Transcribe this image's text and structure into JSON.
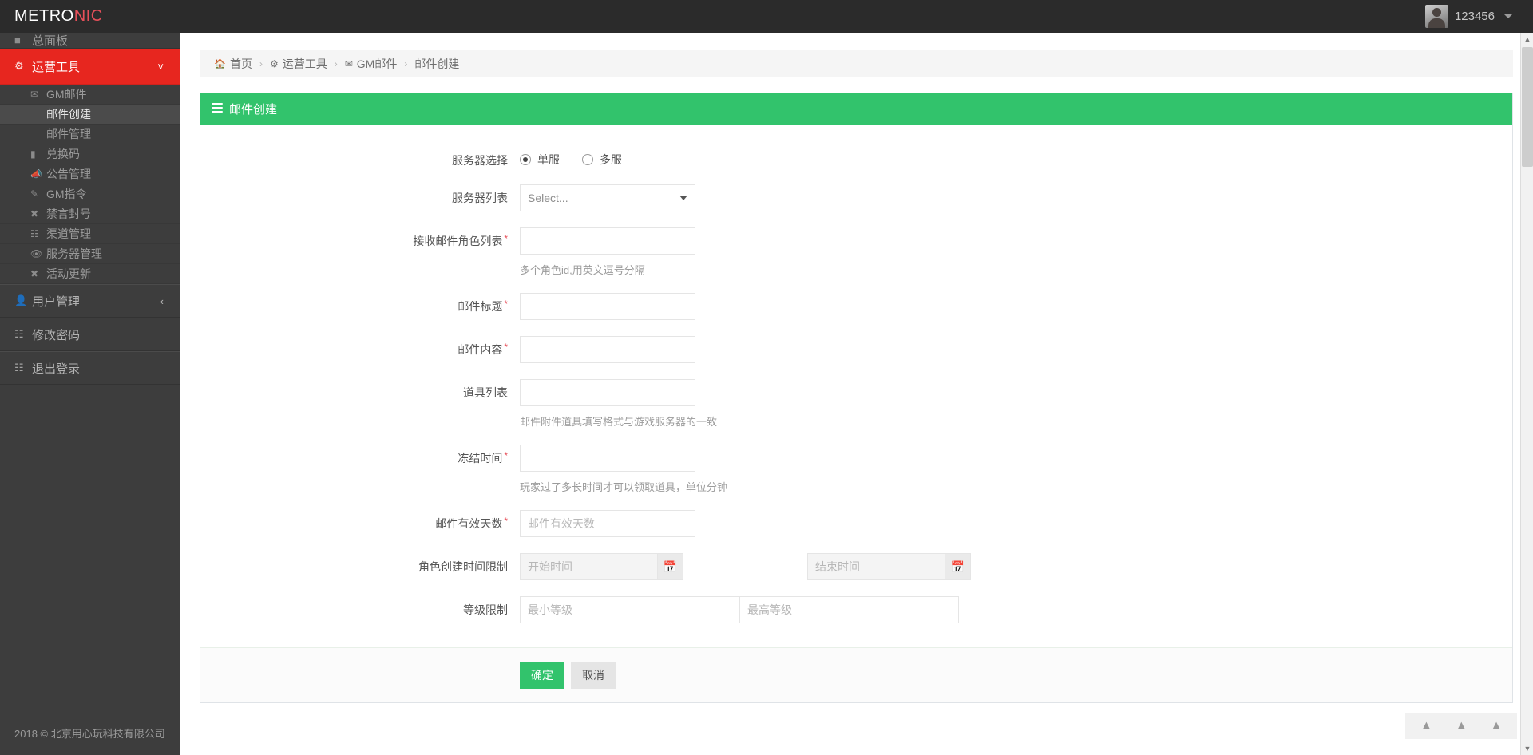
{
  "header": {
    "brand_prefix": "METRO",
    "brand_suffix": "NIC",
    "username": "123456"
  },
  "sidebar": {
    "dashboard_label": "总面板",
    "active_group": {
      "label": "运营工具",
      "icon": "gears-icon"
    },
    "submenu": [
      {
        "label": "GM邮件",
        "icon": "envelope-icon",
        "selected": false,
        "indent": false
      },
      {
        "label": "邮件创建",
        "icon": "",
        "selected": true,
        "indent": true
      },
      {
        "label": "邮件管理",
        "icon": "",
        "selected": false,
        "indent": true
      },
      {
        "label": "兑换码",
        "icon": "barcode-icon",
        "selected": false,
        "indent": false
      },
      {
        "label": "公告管理",
        "icon": "bullhorn-icon",
        "selected": false,
        "indent": false
      },
      {
        "label": "GM指令",
        "icon": "pencil-icon",
        "selected": false,
        "indent": false
      },
      {
        "label": "禁言封号",
        "icon": "ban-icon",
        "selected": false,
        "indent": false
      },
      {
        "label": "渠道管理",
        "icon": "sitemap-icon",
        "selected": false,
        "indent": false
      },
      {
        "label": "服务器管理",
        "icon": "eye-icon",
        "selected": false,
        "indent": false
      },
      {
        "label": "活动更新",
        "icon": "ban-icon",
        "selected": false,
        "indent": false
      }
    ],
    "groups": [
      {
        "label": "用户管理",
        "icon": "user-icon",
        "collapsible": true
      },
      {
        "label": "修改密码",
        "icon": "sitemap-icon",
        "collapsible": false
      },
      {
        "label": "退出登录",
        "icon": "sitemap-icon",
        "collapsible": false
      }
    ]
  },
  "footer": {
    "copyright": "2018 © 北京用心玩科技有限公司"
  },
  "breadcrumb": [
    {
      "label": "首页",
      "icon": "home-icon"
    },
    {
      "label": "运营工具",
      "icon": "gears-icon"
    },
    {
      "label": "GM邮件",
      "icon": "envelope-icon"
    },
    {
      "label": "邮件创建",
      "icon": ""
    }
  ],
  "portlet": {
    "title": "邮件创建"
  },
  "form": {
    "server_select": {
      "label": "服务器选择",
      "options": [
        {
          "label": "单服",
          "checked": true
        },
        {
          "label": "多服",
          "checked": false
        }
      ]
    },
    "server_list": {
      "label": "服务器列表",
      "value": "Select...",
      "options": [
        "Select..."
      ]
    },
    "role_list": {
      "label": "接收邮件角色列表",
      "required": true,
      "value": "",
      "placeholder": "",
      "help": "多个角色id,用英文逗号分隔"
    },
    "mail_title": {
      "label": "邮件标题",
      "required": true,
      "value": "",
      "placeholder": ""
    },
    "mail_content": {
      "label": "邮件内容",
      "required": true,
      "value": "",
      "placeholder": ""
    },
    "item_list": {
      "label": "道具列表",
      "required": false,
      "value": "",
      "placeholder": "",
      "help": "邮件附件道具填写格式与游戏服务器的一致"
    },
    "freeze_time": {
      "label": "冻结时间",
      "required": true,
      "value": "",
      "placeholder": "",
      "help": "玩家过了多长时间才可以领取道具，单位分钟"
    },
    "valid_days": {
      "label": "邮件有效天数",
      "required": true,
      "value": "",
      "placeholder": "邮件有效天数"
    },
    "create_time_limit": {
      "label": "角色创建时间限制",
      "start_placeholder": "开始时间",
      "start_value": "",
      "end_placeholder": "结束时间",
      "end_value": "",
      "calendar_icon": "calendar-icon"
    },
    "level_limit": {
      "label": "等级限制",
      "min_placeholder": "最小等级",
      "min_value": "",
      "max_placeholder": "最高等级",
      "max_value": ""
    },
    "submit_label": "确定",
    "cancel_label": "取消"
  },
  "colors": {
    "brand_accent": "#e7261f",
    "portlet_green": "#32c36c",
    "sidebar_bg": "#3d3d3d",
    "header_bg": "#2b2b2b"
  }
}
